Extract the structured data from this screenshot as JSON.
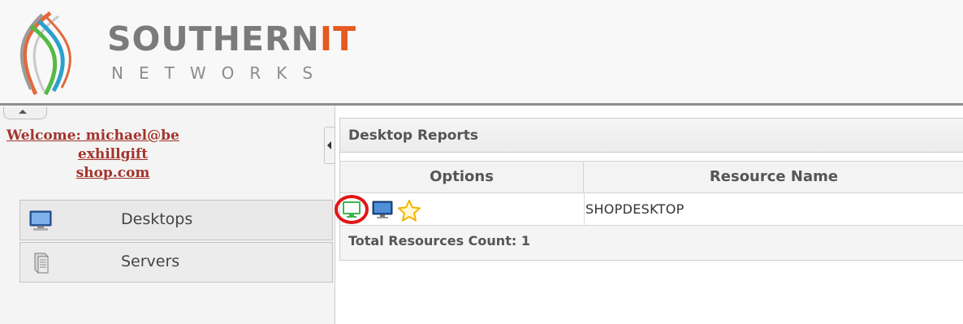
{
  "brand": {
    "name_main": "SOUTHERN",
    "name_accent": "IT",
    "subtitle": "NETWORKS",
    "accent_color": "#e55a1f"
  },
  "user": {
    "welcome_line1": "Welcome: michael@be",
    "welcome_line2": "exhillgift",
    "welcome_line3": "shop.com"
  },
  "nav": {
    "items": [
      {
        "label": "Desktops",
        "icon": "monitor-icon"
      },
      {
        "label": "Servers",
        "icon": "server-icon"
      }
    ]
  },
  "report": {
    "title": "Desktop Reports",
    "columns": [
      "Options",
      "Resource Name"
    ],
    "rows": [
      {
        "options": [
          "connect-desktop-icon",
          "remote-monitor-icon",
          "favorite-star-icon"
        ],
        "resource_name": "SHOPDESKTOP"
      }
    ],
    "total_label": "Total Resources Count: 1"
  },
  "colors": {
    "welcome_link": "#a2342c",
    "highlight_ring": "#e01818",
    "connect_icon": "#3fb54a",
    "star": "#f2b400"
  }
}
